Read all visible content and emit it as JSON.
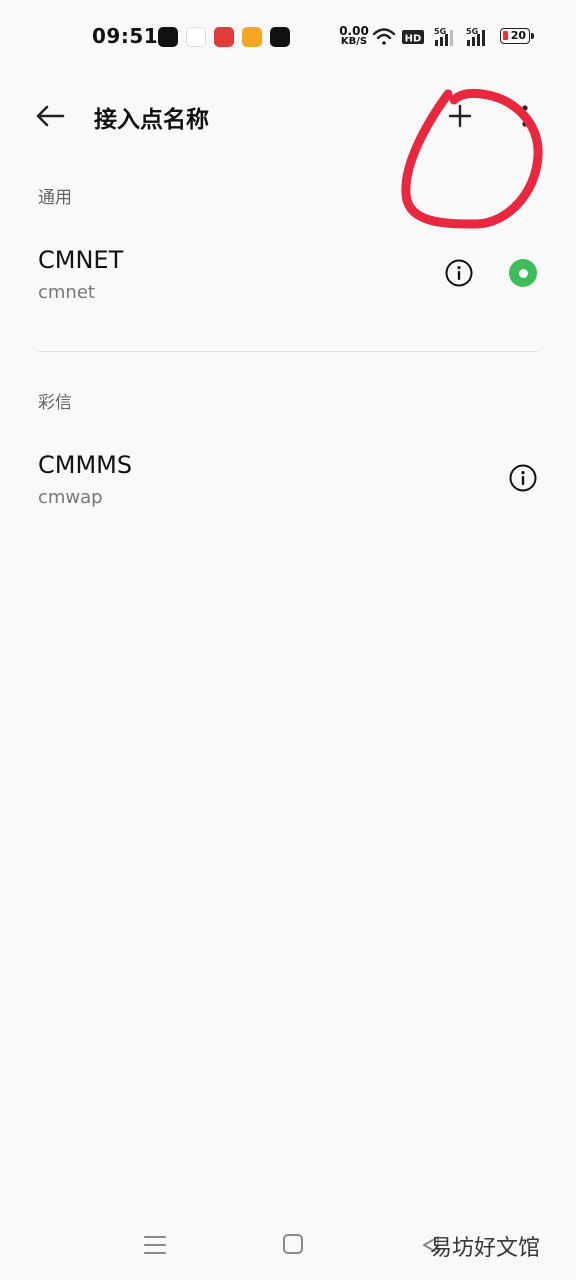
{
  "status_bar": {
    "time": "09:51",
    "net_speed_value": "0.00",
    "net_speed_unit": "KB/S",
    "hd_badge": "HD",
    "signal_1_label": "5G",
    "signal_2_label": "5G",
    "battery_level": "20",
    "icons": [
      "wifi-icon",
      "hd-icon",
      "signal-5g-icon",
      "signal-5g-icon",
      "battery-icon"
    ]
  },
  "toolbar": {
    "title": "接入点名称",
    "back_icon": "arrow-left-icon",
    "add_icon": "plus-icon",
    "more_icon": "more-vertical-icon"
  },
  "sections": [
    {
      "header": "通用",
      "items": [
        {
          "name": "CMNET",
          "apn": "cmnet",
          "selected": true
        }
      ]
    },
    {
      "header": "彩信",
      "items": [
        {
          "name": "CMMMS",
          "apn": "cmwap",
          "selected": false
        }
      ]
    }
  ],
  "colors": {
    "background": "#f9f9f9",
    "selected_radio": "#3cbd5a",
    "annotation": "#e8283f"
  },
  "navigation": {
    "icons": [
      "menu-icon",
      "home-square-icon",
      "back-triangle-icon"
    ]
  },
  "watermark": "易坊好文馆"
}
